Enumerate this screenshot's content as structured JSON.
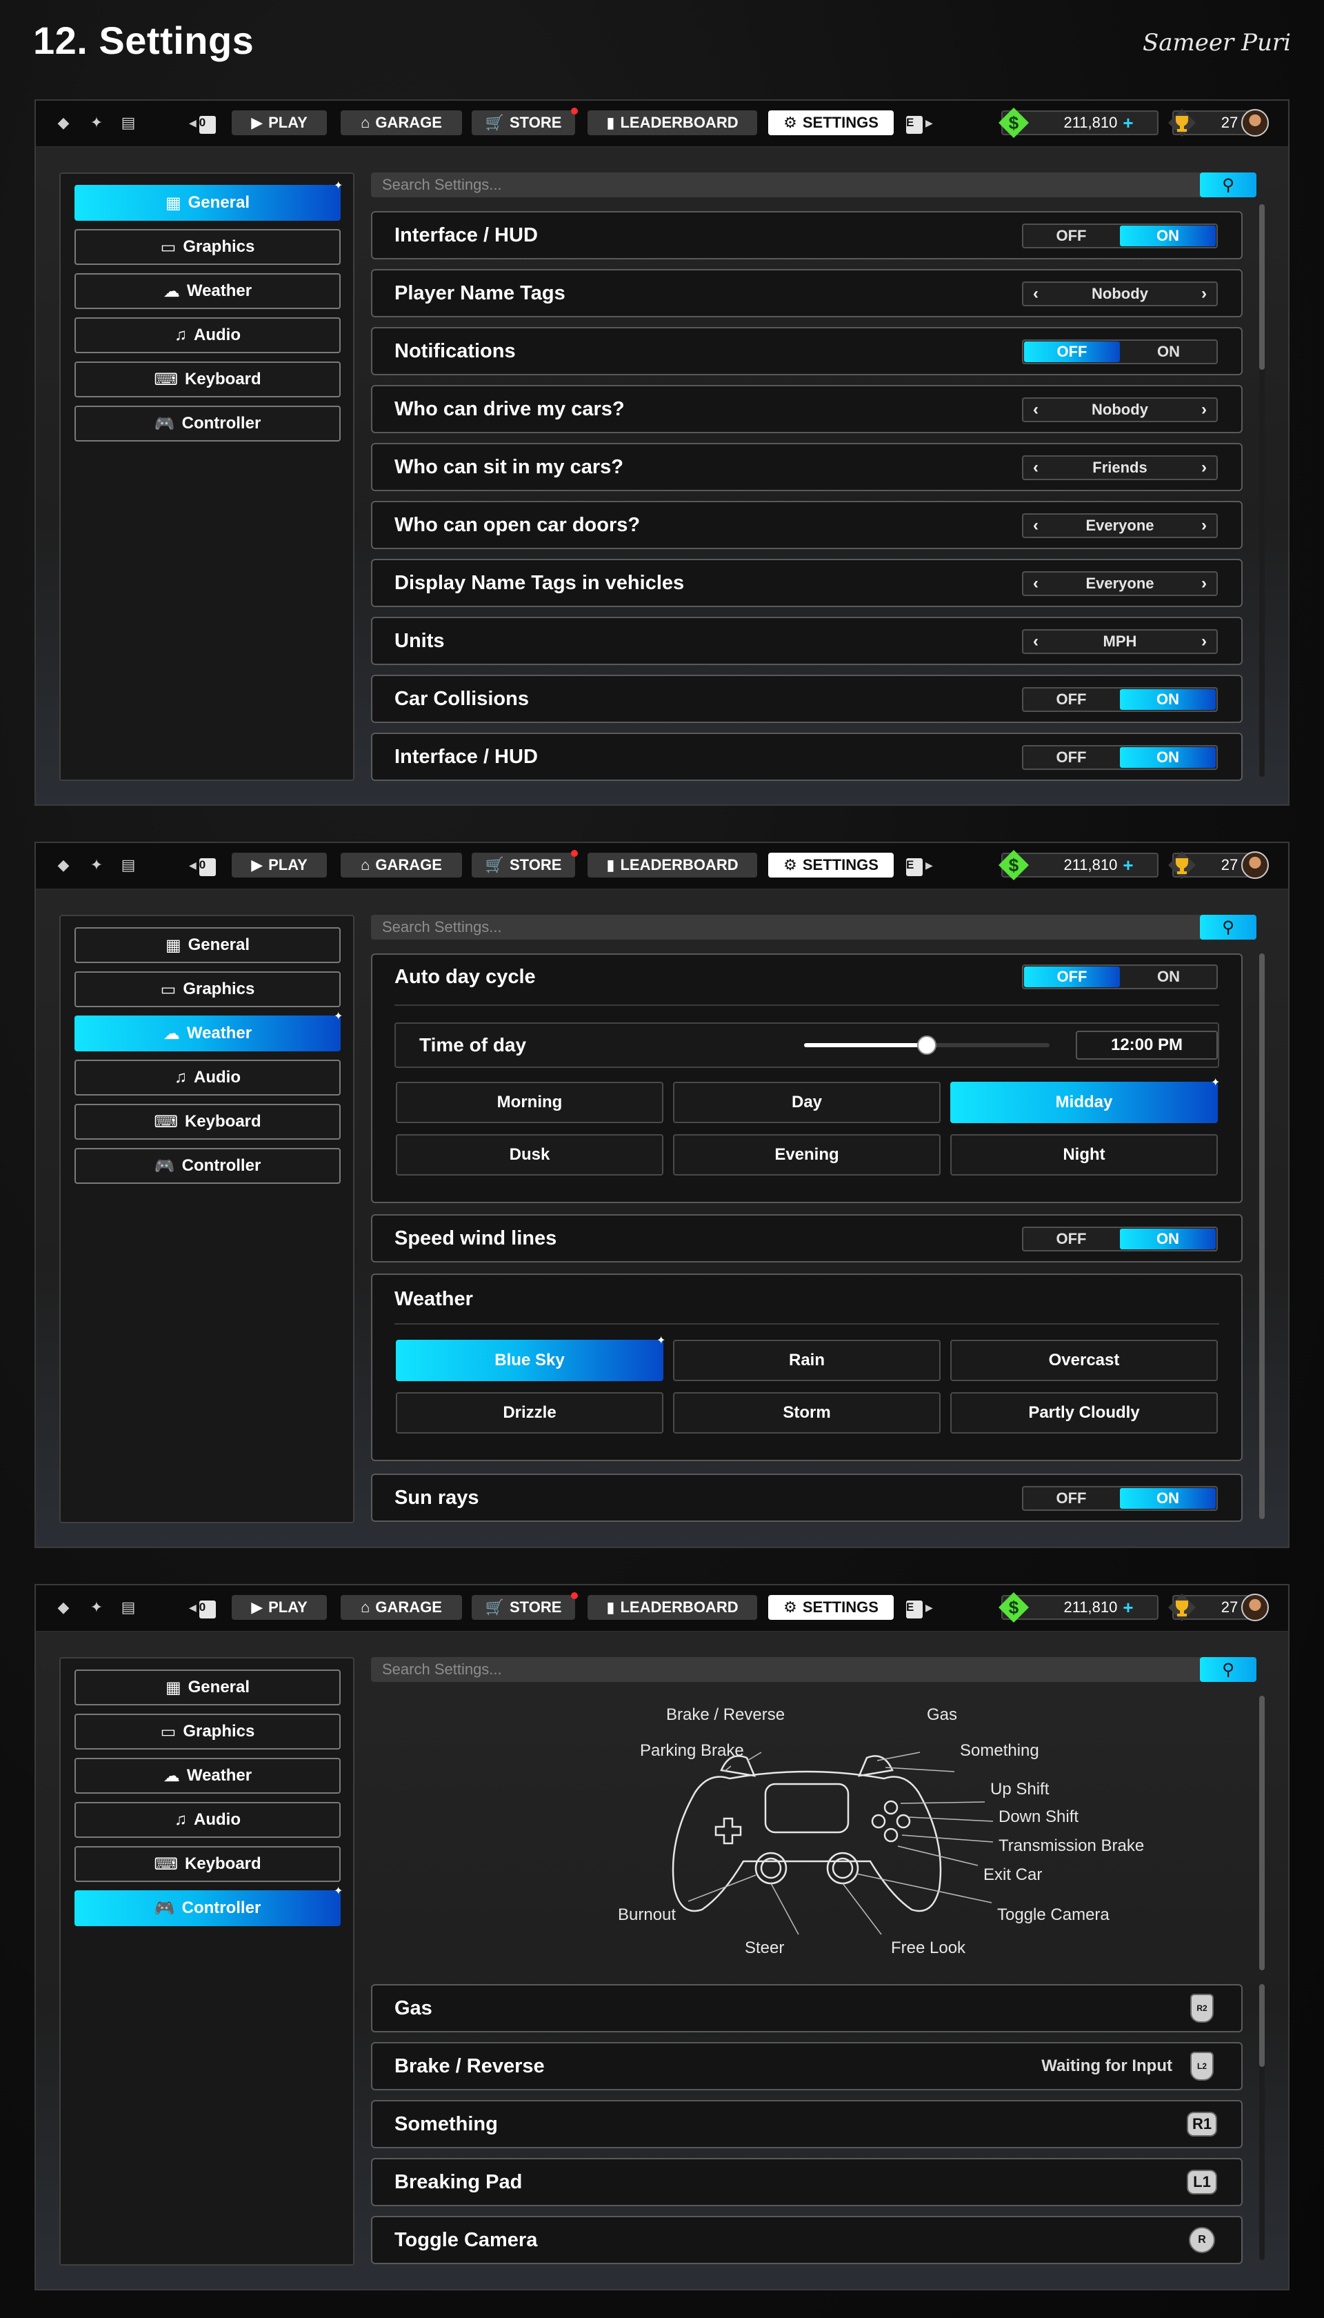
{
  "page_title": "12. Settings",
  "author": "Sameer Puri",
  "topbar": {
    "badge_count": "0",
    "nav": [
      {
        "label": "PLAY",
        "icon": "play-icon"
      },
      {
        "label": "GARAGE",
        "icon": "garage-icon"
      },
      {
        "label": "STORE",
        "icon": "cart-icon"
      },
      {
        "label": "LEADERBOARD",
        "icon": "bar-chart-icon"
      },
      {
        "label": "SETTINGS",
        "icon": "gear-icon"
      }
    ],
    "key_hint": "E",
    "currency": "211,810",
    "trophies": "27"
  },
  "sidebar": [
    {
      "label": "General",
      "icon": "grid-icon"
    },
    {
      "label": "Graphics",
      "icon": "monitor-icon"
    },
    {
      "label": "Weather",
      "icon": "cloud-icon"
    },
    {
      "label": "Audio",
      "icon": "music-icon"
    },
    {
      "label": "Keyboard",
      "icon": "keyboard-icon"
    },
    {
      "label": "Controller",
      "icon": "gamepad-icon"
    }
  ],
  "search_placeholder": "Search Settings...",
  "toggle_labels": {
    "off": "OFF",
    "on": "ON"
  },
  "general": {
    "rows": [
      {
        "label": "Interface / HUD",
        "type": "toggle",
        "value": "ON"
      },
      {
        "label": "Player Name Tags",
        "type": "select",
        "value": "Nobody"
      },
      {
        "label": "Notifications",
        "type": "toggle",
        "value": "OFF"
      },
      {
        "label": "Who can drive my cars?",
        "type": "select",
        "value": "Nobody"
      },
      {
        "label": "Who can sit in my cars?",
        "type": "select",
        "value": "Friends"
      },
      {
        "label": "Who can open car doors?",
        "type": "select",
        "value": "Everyone"
      },
      {
        "label": "Display Name Tags in vehicles",
        "type": "select",
        "value": "Everyone"
      },
      {
        "label": "Units",
        "type": "select",
        "value": "MPH"
      },
      {
        "label": "Car Collisions",
        "type": "toggle",
        "value": "ON"
      },
      {
        "label": "Interface / HUD",
        "type": "toggle",
        "value": "ON"
      }
    ]
  },
  "weather": {
    "auto_day_cycle": {
      "label": "Auto day cycle",
      "value": "OFF"
    },
    "time_of_day": {
      "label": "Time of day",
      "value": "12:00 PM",
      "slider_fraction": 0.5
    },
    "time_options": [
      "Morning",
      "Day",
      "Midday",
      "Dusk",
      "Evening",
      "Night"
    ],
    "time_selected": "Midday",
    "speed_wind_lines": {
      "label": "Speed wind lines",
      "value": "ON"
    },
    "weather_title": "Weather",
    "weather_options": [
      "Blue Sky",
      "Rain",
      "Overcast",
      "Drizzle",
      "Storm",
      "Partly Cloudly"
    ],
    "weather_selected": "Blue Sky",
    "sun_rays": {
      "label": "Sun rays",
      "value": "ON"
    }
  },
  "controller": {
    "diagram_labels": {
      "brake_reverse": "Brake / Reverse",
      "parking_brake": "Parking Brake",
      "gas": "Gas",
      "something": "Something",
      "up_shift": "Up Shift",
      "down_shift": "Down Shift",
      "transmission_brake": "Transmission Brake",
      "exit_car": "Exit Car",
      "toggle_camera": "Toggle Camera",
      "burnout": "Burnout",
      "steer": "Steer",
      "free_look": "Free Look"
    },
    "bindings": [
      {
        "label": "Gas",
        "glyph": "R2",
        "status": ""
      },
      {
        "label": "Brake / Reverse",
        "glyph": "L2",
        "status": "Waiting for Input"
      },
      {
        "label": "Something",
        "glyph": "R1",
        "status": ""
      },
      {
        "label": "Breaking Pad",
        "glyph": "L1",
        "status": ""
      },
      {
        "label": "Toggle Camera",
        "glyph": "R",
        "status": ""
      }
    ]
  }
}
